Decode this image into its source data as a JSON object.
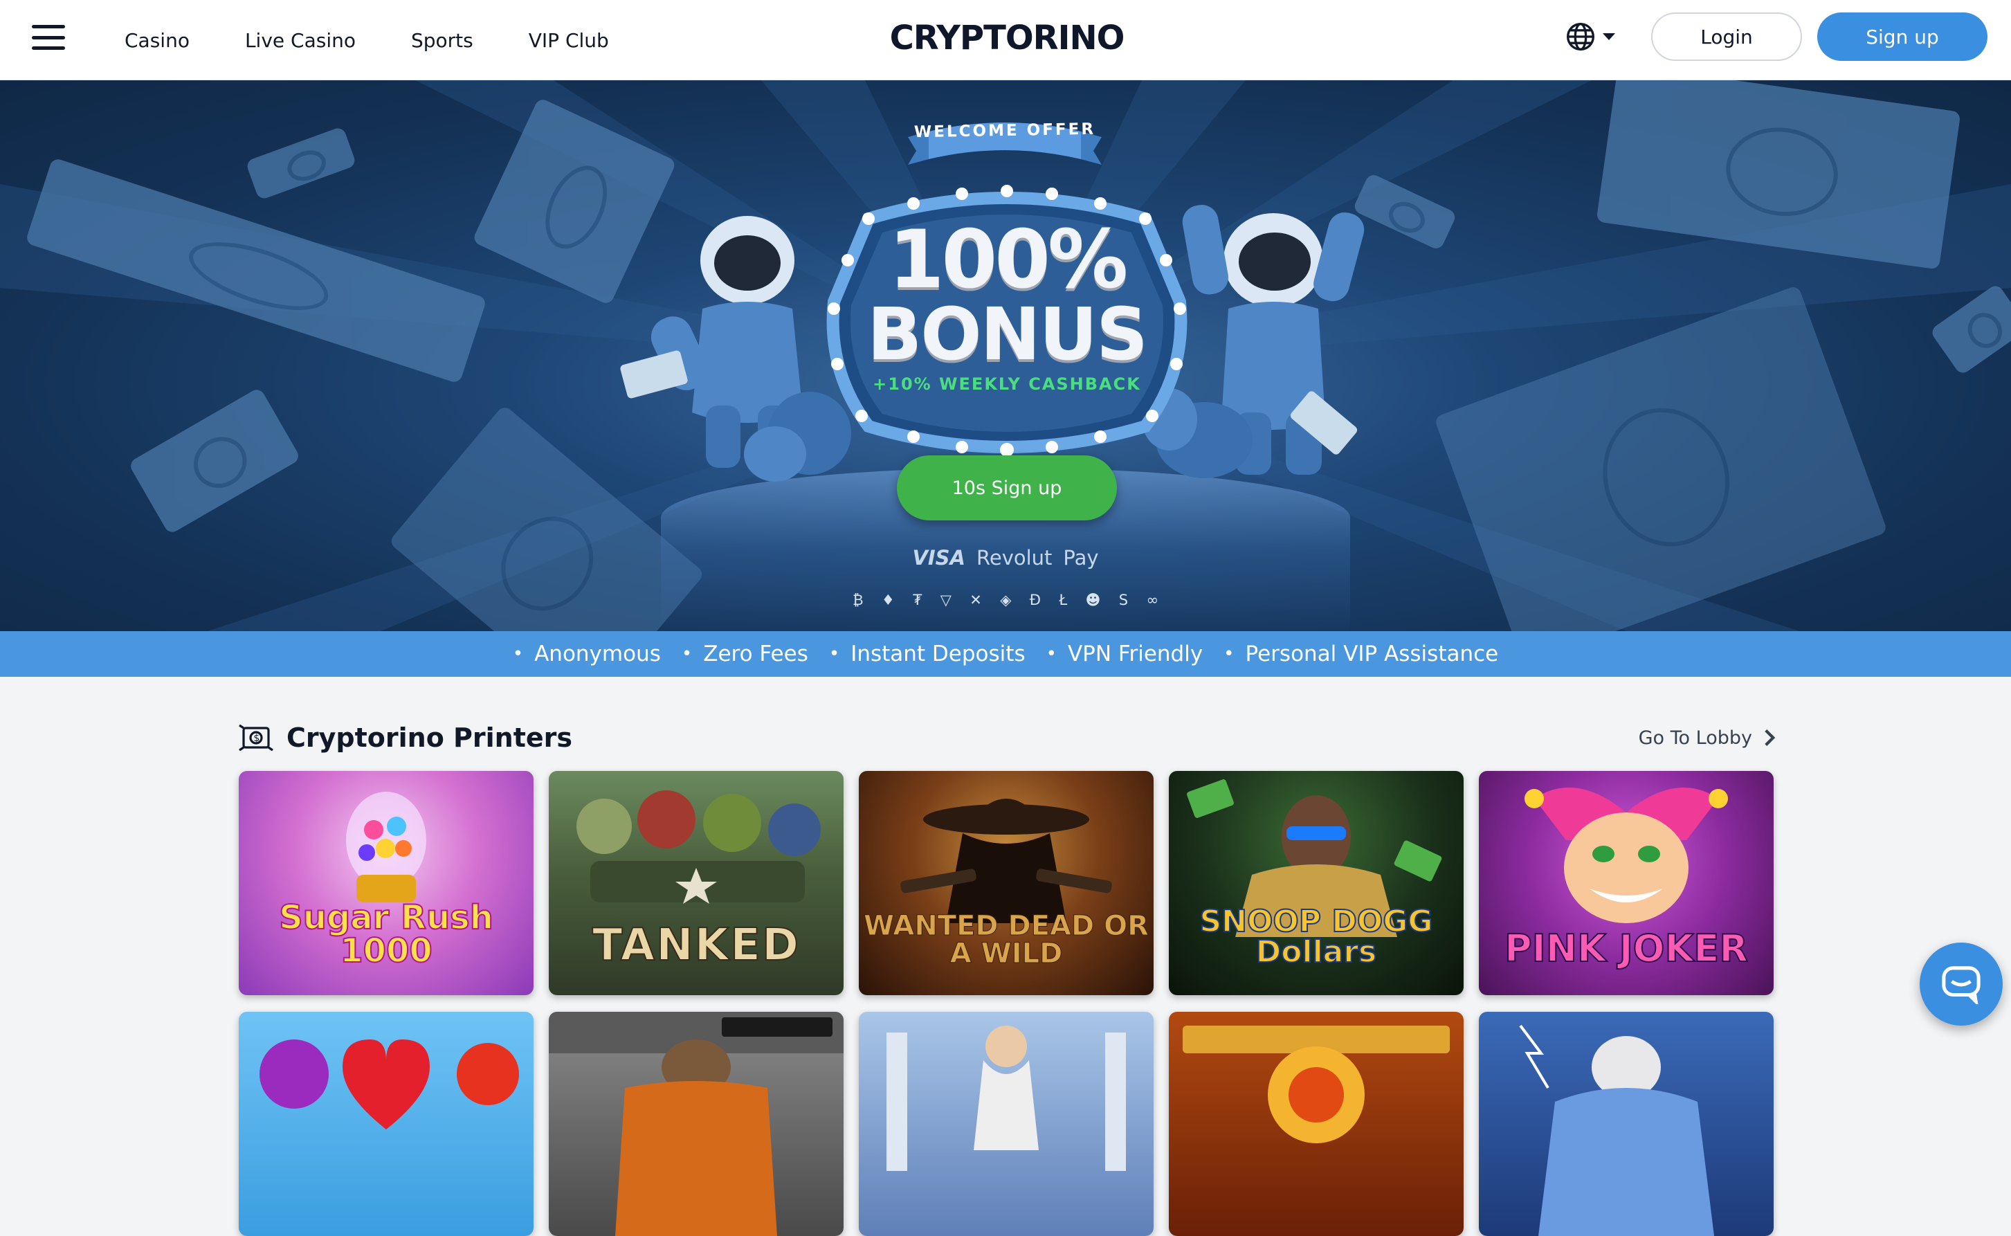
{
  "header": {
    "nav": [
      "Casino",
      "Live Casino",
      "Sports",
      "VIP Club"
    ],
    "logo": "CRYPTORINO",
    "login_label": "Login",
    "signup_label": "Sign up",
    "language_icon": "globe-icon"
  },
  "hero": {
    "ribbon": "WELCOME OFFER",
    "bonus_pct": "100%",
    "bonus_word": "BONUS",
    "cashback": "+10% WEEKLY CASHBACK",
    "cta_label": "10s Sign up",
    "payments": {
      "visa": "VISA",
      "revolut": "Revolut",
      "applepay": " Pay"
    },
    "crypto_icons": [
      "₿",
      "♦",
      "₮",
      "▽",
      "✕",
      "◈",
      "Ð",
      "Ł",
      "☻",
      "S",
      "∞"
    ]
  },
  "features": [
    "Anonymous",
    "Zero Fees",
    "Instant Deposits",
    "VPN Friendly",
    "Personal VIP Assistance"
  ],
  "section": {
    "title": "Cryptorino Printers",
    "go_lobby": "Go To Lobby"
  },
  "games": [
    {
      "title": "Sugar Rush 1000"
    },
    {
      "title": "TANKED"
    },
    {
      "title": "WANTED DEAD OR A WILD"
    },
    {
      "title": "SNOOP DOGG Dollars"
    },
    {
      "title": "PINK JOKER"
    }
  ],
  "colors": {
    "brand_blue": "#3b8fe0",
    "cta_green": "#3fb24a",
    "features_bar": "#4a97df",
    "hero_bg": "#143256"
  }
}
